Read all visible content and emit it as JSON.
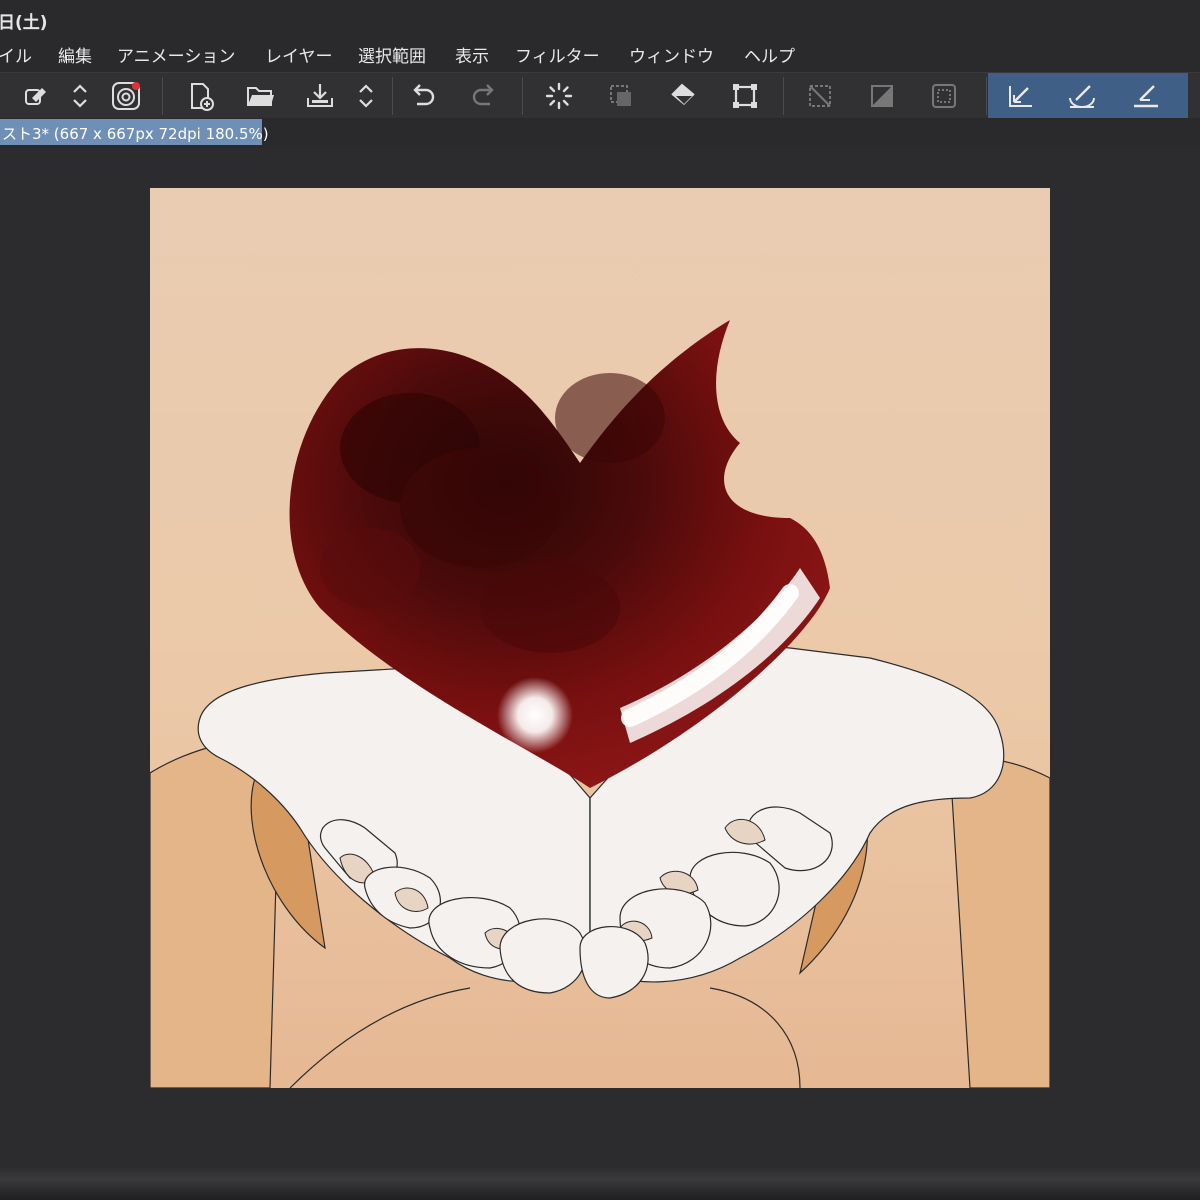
{
  "window": {
    "title": "日(土)"
  },
  "menu": {
    "items": [
      "イル",
      "編集",
      "アニメーション",
      "レイヤー",
      "選択範囲",
      "表示",
      "フィルター",
      "ウィンドウ",
      "ヘルプ"
    ]
  },
  "toolbar": {
    "icons": [
      "eyedropper-icon",
      "updown-arrows-icon",
      "app-logo-icon",
      "new-file-icon",
      "open-folder-icon",
      "save-icon",
      "updown-arrows-icon",
      "undo-icon",
      "redo-icon",
      "loading-spinner-icon",
      "transform-selection-icon",
      "fill-icon",
      "crop-icon",
      "deselect-icon",
      "invert-selection-icon",
      "selection-border-icon",
      "pen-stroke-icon",
      "brush-stroke-icon",
      "eraser-stroke-icon"
    ],
    "active_group_color": "#3f5f86"
  },
  "document_tab": {
    "label": "スト3* (667 x 667px 72dpi 180.5%)"
  },
  "canvas": {
    "content": "heart-in-hands-illustration",
    "colors": {
      "background": "#e9c7a9",
      "heart": "#7a0f0f",
      "hands": "#f4f1ee",
      "wrist": "#d69a61"
    }
  }
}
